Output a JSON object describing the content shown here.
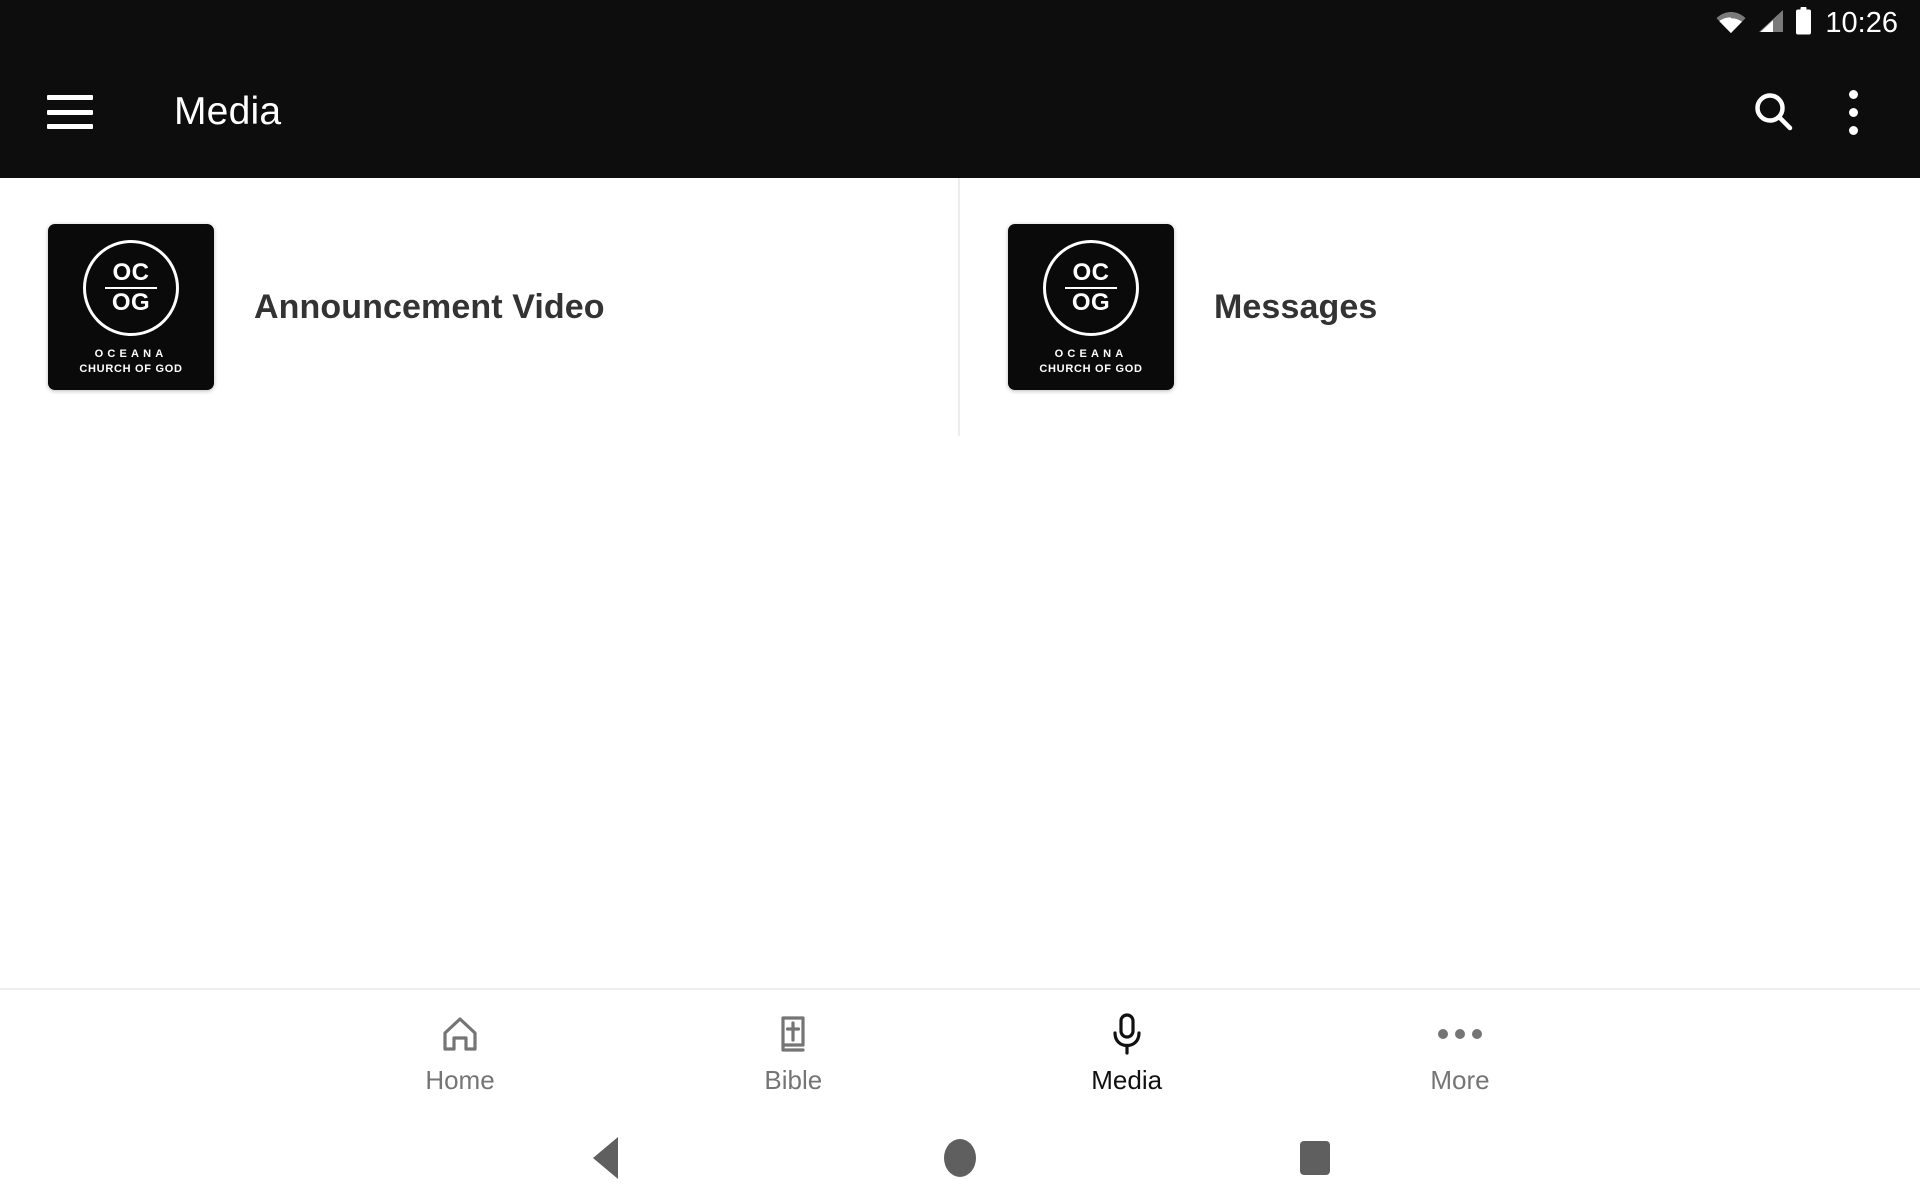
{
  "status_bar": {
    "time": "10:26",
    "icons": [
      "wifi-icon",
      "cellular-signal-icon",
      "battery-icon"
    ]
  },
  "app_bar": {
    "menu_icon": "hamburger-menu-icon",
    "title": "Media",
    "search_icon": "search-icon",
    "overflow_icon": "overflow-menu-icon"
  },
  "logo": {
    "line1": "OC",
    "line2": "OG",
    "name": "OCEANA",
    "subtitle": "CHURCH OF GOD"
  },
  "media_items": [
    {
      "label": "Announcement Video",
      "thumbnail": "ocog-logo-thumbnail"
    },
    {
      "label": "Messages",
      "thumbnail": "ocog-logo-thumbnail"
    }
  ],
  "tab_bar": {
    "tabs": [
      {
        "label": "Home",
        "icon": "house-icon",
        "active": false
      },
      {
        "label": "Bible",
        "icon": "bible-book-icon",
        "active": false
      },
      {
        "label": "Media",
        "icon": "microphone-icon",
        "active": true
      },
      {
        "label": "More",
        "icon": "more-dots-icon",
        "active": false
      }
    ]
  },
  "nav_bar": {
    "back": "back-triangle-icon",
    "home": "home-circle-icon",
    "recents": "recents-square-icon"
  },
  "colors": {
    "app_bar_bg": "#0d0d0d",
    "page_bg": "#ffffff",
    "divider": "#ededed",
    "label_text": "#333333",
    "tab_inactive": "#757575",
    "tab_active": "#111111",
    "system_nav_icon": "#5f5f5f"
  }
}
